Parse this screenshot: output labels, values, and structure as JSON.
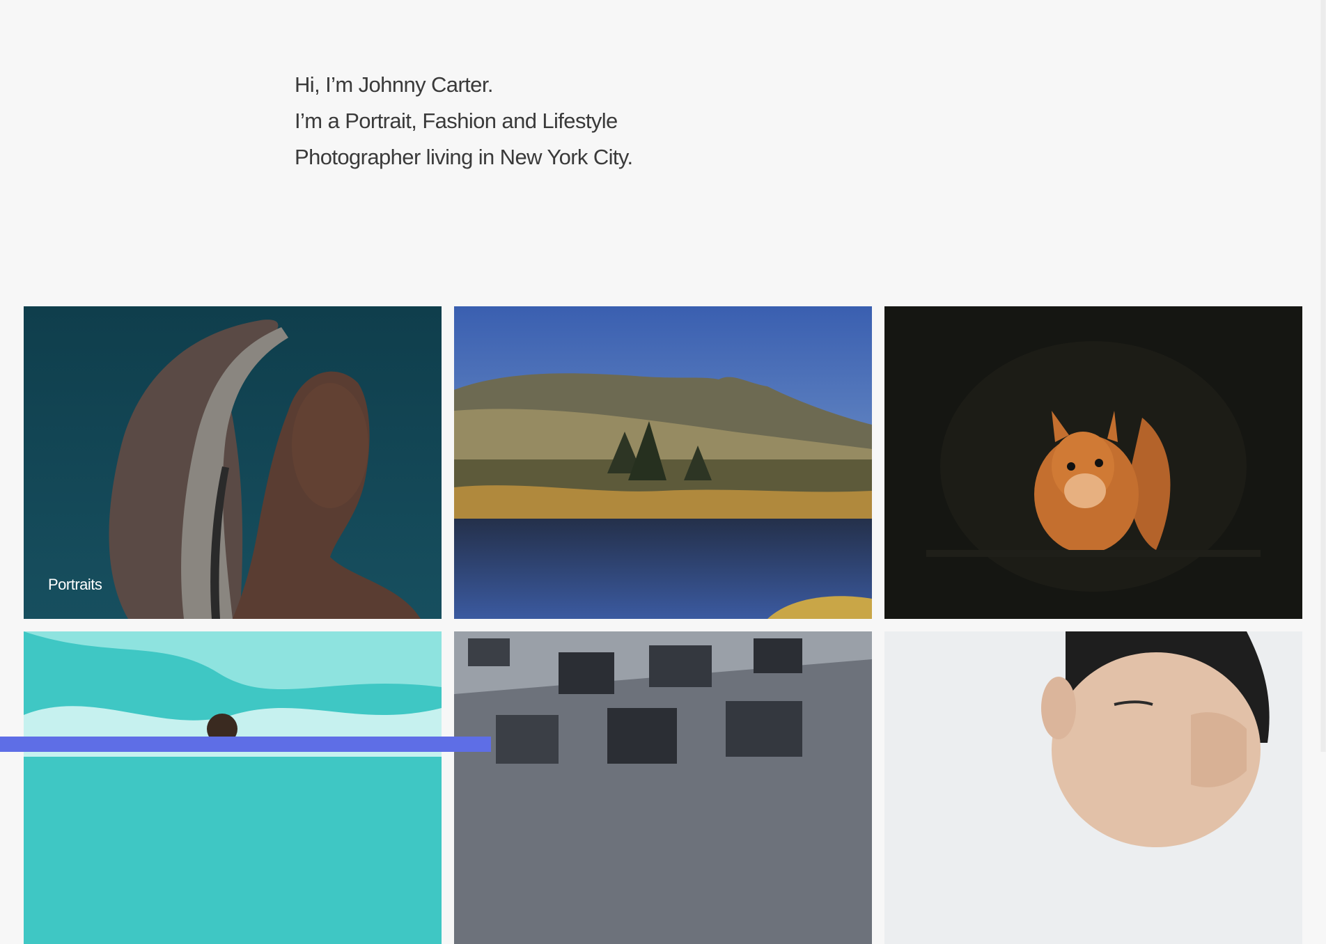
{
  "intro": {
    "line1": "Hi, I’m Johnny Carter.",
    "line2": "I’m a Portrait, Fashion and Lifestyle",
    "line3": "Photographer living in New York City."
  },
  "gallery": {
    "tiles": [
      {
        "label": "Portraits",
        "subject": "woman-in-headscarf-portrait"
      },
      {
        "label": "",
        "subject": "mountain-lake-landscape"
      },
      {
        "label": "",
        "subject": "red-squirrel-wildlife"
      },
      {
        "label": "",
        "subject": "surfer-in-wave"
      },
      {
        "label": "",
        "subject": "building-facade-architecture"
      },
      {
        "label": "",
        "subject": "man-covering-eye-portrait"
      }
    ]
  },
  "colors": {
    "background": "#f7f7f7",
    "text": "#3a3a3a",
    "accent_bar": "#5e6ee6"
  }
}
